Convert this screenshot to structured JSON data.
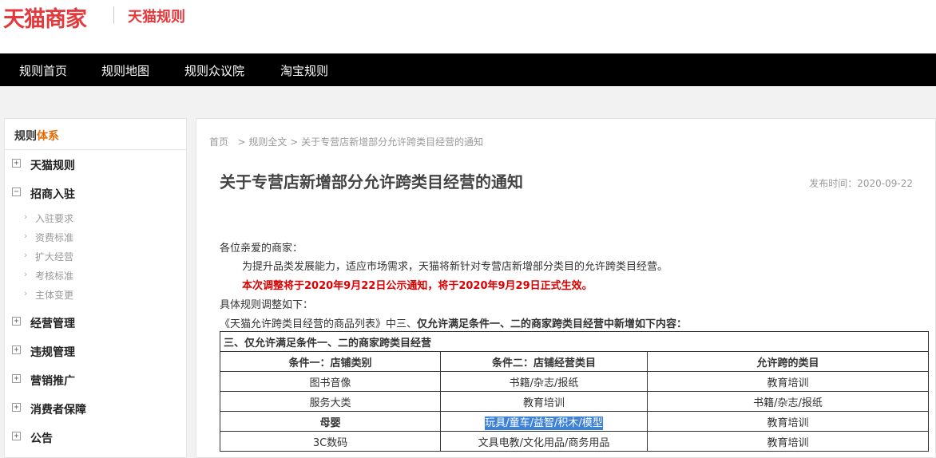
{
  "header": {
    "logo": "天猫商家",
    "sub_logo": "天猫规则"
  },
  "nav": {
    "items": [
      "规则首页",
      "规则地图",
      "规则众议院",
      "淘宝规则"
    ]
  },
  "sidebar": {
    "title_main": "规则",
    "title_accent": "体系",
    "groups": [
      {
        "label": "天猫规则"
      },
      {
        "label": "招商入驻",
        "expanded": true,
        "children": [
          "入驻要求",
          "资费标准",
          "扩大经营",
          "考核标准",
          "主体变更"
        ]
      },
      {
        "label": "经营管理"
      },
      {
        "label": "违规管理"
      },
      {
        "label": "营销推广"
      },
      {
        "label": "消费者保障"
      },
      {
        "label": "公告"
      }
    ],
    "plus_icon": "⊞",
    "minus_icon": "⊟",
    "arrow_icon": "›"
  },
  "breadcrumb": {
    "home": "首页",
    "sep": ">",
    "full": "规则全文",
    "current": "关于专营店新增部分允许跨类目经营的通知"
  },
  "article": {
    "title": "关于专营店新增部分允许跨类目经营的通知",
    "pub_label": "发布时间：",
    "pub_date": "2020-09-22",
    "greeting": "各位亲爱的商家：",
    "p1": "为提升品类发展能力，适应市场需求，天猫将新针对专营店新增部分类目的允许跨类目经营。",
    "p2_red": "本次调整将于2020年9月22日公示通知，将于2020年9月29日正式生效。",
    "p3": "具体规则调整如下：",
    "p4_normal": "《天猫允许跨类目经营的商品列表》中三、",
    "p4_bold": "仅允许满足条件一、二的商家跨类目经营中新增如下内容："
  },
  "table": {
    "caption": "三、仅允许满足条件一、二的商家跨类目经营",
    "headers": [
      "条件一：店铺类别",
      "条件二：店铺经营类目",
      "允许跨的类目"
    ],
    "rows": [
      [
        "图书音像",
        "书籍/杂志/报纸",
        "教育培训"
      ],
      [
        "服务大类",
        "教育培训",
        "书籍/杂志/报纸"
      ],
      [
        "母婴",
        "玩具/童车/益智/积木/模型",
        "教育培训"
      ],
      [
        "3C数码",
        "文具电教/文化用品/商务用品",
        "教育培训"
      ]
    ]
  },
  "colors": {
    "brand_red": "#e4393c",
    "nav_bg": "#000000",
    "accent_orange": "#e36c09",
    "notice_red": "#dd0000",
    "selection_blue": "#3d82d6"
  }
}
